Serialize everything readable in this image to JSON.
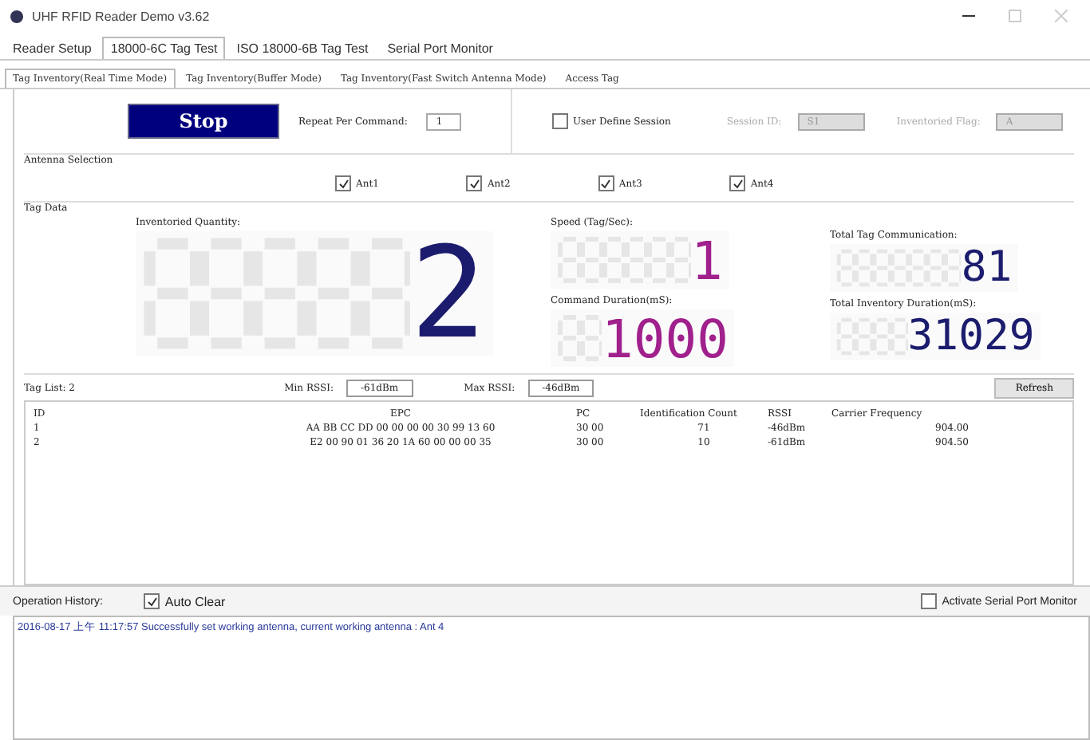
{
  "window": {
    "title": "UHF RFID Reader Demo v3.62"
  },
  "menu_tabs": [
    {
      "label": "Reader Setup",
      "selected": false
    },
    {
      "label": "18000-6C Tag Test",
      "selected": true
    },
    {
      "label": "ISO 18000-6B Tag Test",
      "selected": false
    },
    {
      "label": "Serial Port Monitor",
      "selected": false
    }
  ],
  "sub_tabs": [
    {
      "label": "Tag Inventory(Real Time Mode)",
      "selected": true
    },
    {
      "label": "Tag Inventory(Buffer Mode)",
      "selected": false
    },
    {
      "label": "Tag Inventory(Fast Switch Antenna Mode)",
      "selected": false
    },
    {
      "label": "Access Tag",
      "selected": false
    }
  ],
  "controls": {
    "stop_button": "Stop",
    "repeat_label": "Repeat Per Command:",
    "repeat_value": "1",
    "user_session": {
      "label": "User Define Session",
      "checked": false
    },
    "session_label": "Session ID:",
    "session_value": "S1",
    "flag_label": "Inventoried Flag:",
    "flag_value": "A",
    "disabled": true
  },
  "antenna_selection": {
    "title": "Antenna Selection",
    "antennas": [
      {
        "label": "Ant1",
        "checked": true
      },
      {
        "label": "Ant2",
        "checked": true
      },
      {
        "label": "Ant3",
        "checked": true
      },
      {
        "label": "Ant4",
        "checked": true
      }
    ]
  },
  "tag_data": {
    "title": "Tag Data",
    "displays": [
      {
        "label": "Inventoried Quantity:",
        "value": "2",
        "color": "#1c1c6e"
      },
      {
        "label": "Speed (Tag/Sec):",
        "value": "1",
        "color": "#a0208c"
      },
      {
        "label": "Command Duration(mS):",
        "value": "1000",
        "color": "#a0208c"
      },
      {
        "label": "Total Tag Communication:",
        "value": "81",
        "color": "#1c1c6e"
      },
      {
        "label": "Total Inventory Duration(mS):",
        "value": "31029",
        "color": "#1c1c6e"
      }
    ]
  },
  "tag_list": {
    "title": "Tag List: 2",
    "min_rssi_label": "Min RSSI:",
    "min_rssi": "-61dBm",
    "max_rssi_label": "Max RSSI:",
    "max_rssi": "-46dBm",
    "refresh_button": "Refresh",
    "columns": [
      "ID",
      "EPC",
      "PC",
      "Identification Count",
      "RSSI",
      "Carrier Frequency"
    ],
    "rows": [
      [
        "1",
        "AA BB CC DD 00 00 00 00 30 99 13 60",
        "30 00",
        "71",
        "-46dBm",
        "904.00"
      ],
      [
        "2",
        "E2 00 90 01 36 20 1A 60 00 00 00 35",
        "30 00",
        "10",
        "-61dBm",
        "904.50"
      ]
    ]
  },
  "operation_history": {
    "label": "Operation History:",
    "auto_clear": {
      "label": "Auto Clear",
      "checked": true
    },
    "serial_monitor": {
      "label": "Activate Serial Port Monitor",
      "checked": false
    },
    "log": [
      "2016-08-17 上午 11:17:57 Successfully set working antenna, current working antenna : Ant 4"
    ]
  }
}
